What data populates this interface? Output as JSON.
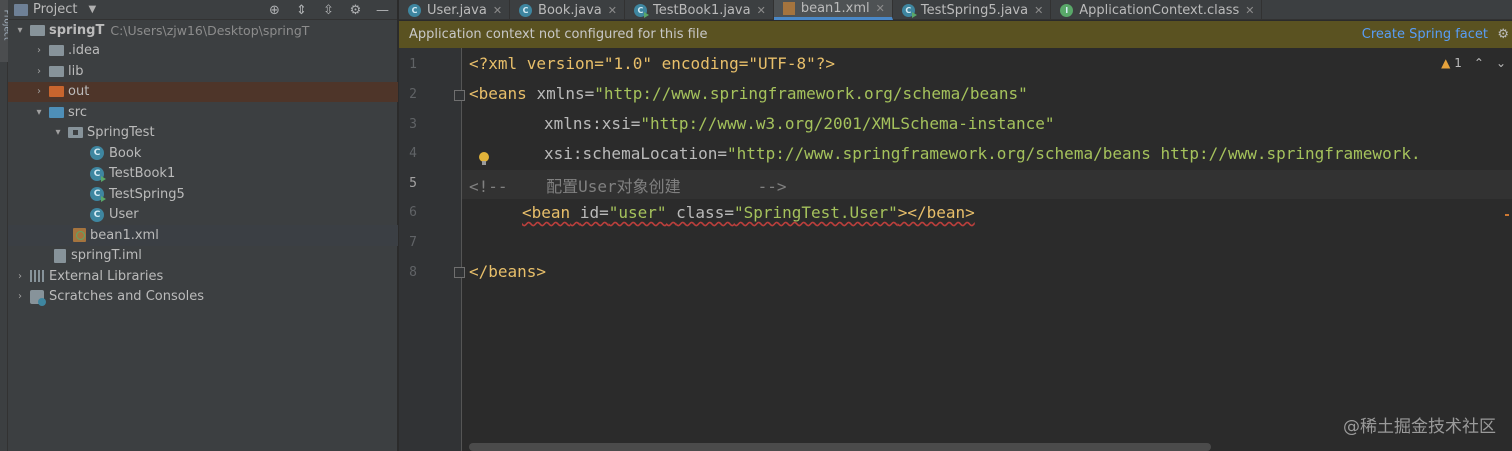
{
  "stripe": {
    "label": "Project"
  },
  "project_panel": {
    "title": "Project",
    "tree": [
      {
        "label": "springT",
        "path": "C:\\Users\\zjw16\\Desktop\\springT"
      },
      {
        "label": ".idea"
      },
      {
        "label": "lib"
      },
      {
        "label": "out"
      },
      {
        "label": "src"
      },
      {
        "label": "SpringTest"
      },
      {
        "label": "Book"
      },
      {
        "label": "TestBook1"
      },
      {
        "label": "TestSpring5"
      },
      {
        "label": "User"
      },
      {
        "label": "bean1.xml"
      },
      {
        "label": "springT.iml"
      },
      {
        "label": "External Libraries"
      },
      {
        "label": "Scratches and Consoles"
      }
    ]
  },
  "tabs": [
    {
      "label": "User.java"
    },
    {
      "label": "Book.java"
    },
    {
      "label": "TestBook1.java"
    },
    {
      "label": "bean1.xml"
    },
    {
      "label": "TestSpring5.java"
    },
    {
      "label": "ApplicationContext.class"
    }
  ],
  "notification": {
    "message": "Application context not configured for this file",
    "action": "Create Spring facet"
  },
  "inspection": {
    "warning_count": "1"
  },
  "editor": {
    "line_numbers": [
      "1",
      "2",
      "3",
      "4",
      "5",
      "6",
      "7",
      "8"
    ],
    "lines": {
      "l1_decl": "<?xml version=\"1.0\" encoding=\"UTF-8\"?>",
      "l2_open": "<beans",
      "l2_attr": "xmlns=",
      "l2_val": "\"http://www.springframework.org/schema/beans\"",
      "l3_attr": "xmlns:xsi=",
      "l3_val": "\"http://www.w3.org/2001/XMLSchema-instance\"",
      "l4_attr": "xsi:schemaLocation=",
      "l4_val": "\"http://www.springframework.org/schema/beans http://www.springframework.",
      "l5_comment": "<!--    配置User对象创建        -->",
      "l6_open": "<bean",
      "l6_attr1": "id=",
      "l6_val1": "\"user\"",
      "l6_attr2": "class=",
      "l6_val2": "\"SpringTest.User\"",
      "l6_close": "></bean>",
      "l8_close": "</beans>"
    }
  },
  "watermark": "@稀土掘金技术社区"
}
